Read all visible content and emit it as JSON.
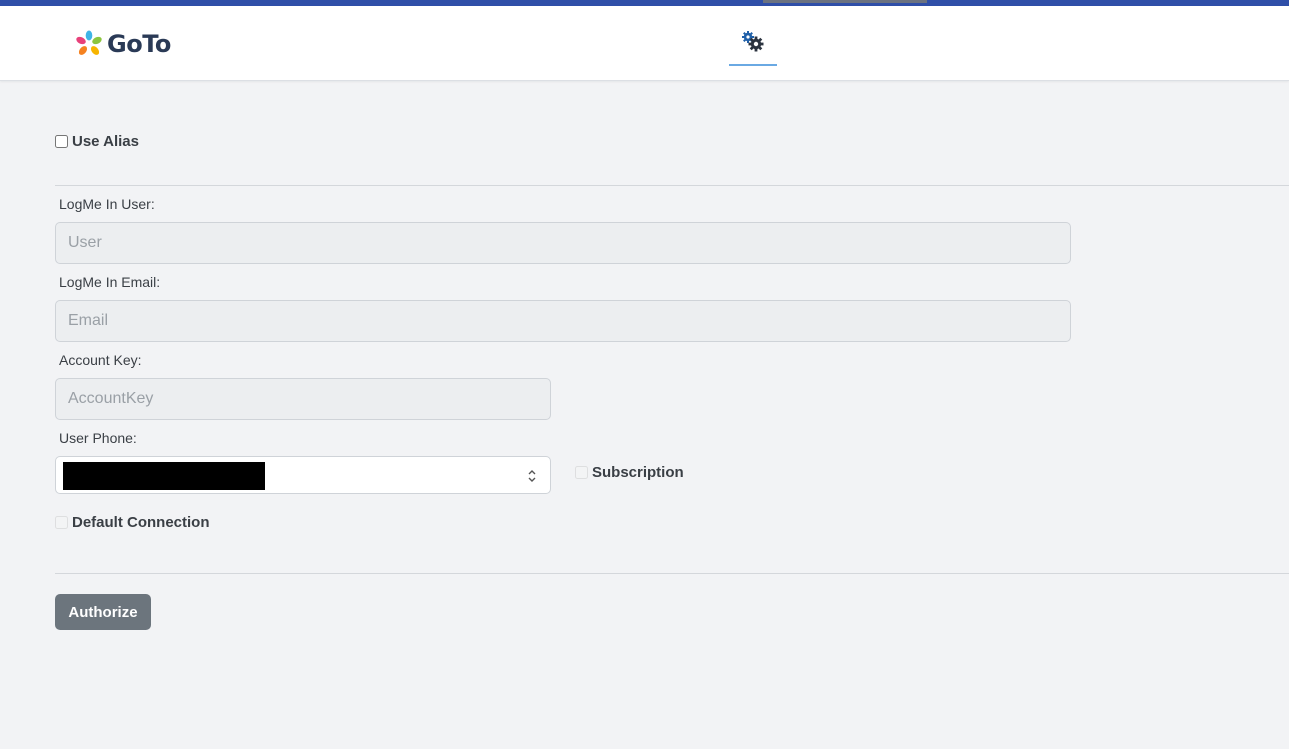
{
  "header": {
    "logo_text": "GoTo",
    "settings_tab_icon": "gears-icon"
  },
  "form": {
    "use_alias_label": "Use Alias",
    "use_alias_checked": false,
    "user": {
      "label": "LogMe In User:",
      "placeholder": "User",
      "value": ""
    },
    "email": {
      "label": "LogMe In Email:",
      "placeholder": "Email",
      "value": ""
    },
    "account_key": {
      "label": "Account Key:",
      "placeholder": "AccountKey",
      "value": ""
    },
    "user_phone": {
      "label": "User Phone:",
      "value_redacted": true
    },
    "subscription_label": "Subscription",
    "subscription_checked": false,
    "default_connection_label": "Default Connection",
    "default_connection_checked": false,
    "authorize_label": "Authorize"
  },
  "colors": {
    "top_stripe": "#2f4fa8",
    "tab_underline": "#6aa9e3",
    "button_bg": "#6c757d",
    "page_bg": "#f2f3f5"
  }
}
